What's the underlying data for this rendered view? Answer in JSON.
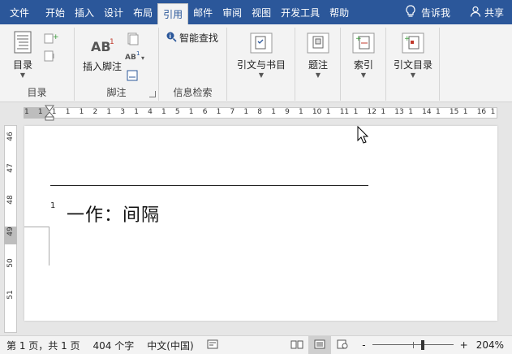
{
  "tabs": [
    {
      "label": "文件"
    },
    {
      "label": "开始"
    },
    {
      "label": "插入"
    },
    {
      "label": "设计"
    },
    {
      "label": "布局"
    },
    {
      "label": "引用"
    },
    {
      "label": "邮件"
    },
    {
      "label": "审阅"
    },
    {
      "label": "视图"
    },
    {
      "label": "开发工具"
    },
    {
      "label": "帮助"
    }
  ],
  "active_tab": "引用",
  "tell_me": "告诉我",
  "share": "共享",
  "ribbon": {
    "toc": {
      "label": "目录",
      "group": "目录"
    },
    "footnote": {
      "label": "插入脚注",
      "group": "脚注"
    },
    "research": {
      "label": "智能查找",
      "group": "信息检索"
    },
    "citations": {
      "label": "引文与书目"
    },
    "captions": {
      "label": "题注"
    },
    "index": {
      "label": "索引"
    },
    "toa": {
      "label": "引文目录"
    }
  },
  "hruler": {
    "labels": [
      "1",
      "1",
      "1",
      "1",
      "1",
      "2",
      "1",
      "3",
      "1",
      "4",
      "1",
      "5",
      "1",
      "6",
      "1",
      "7",
      "1",
      "8",
      "1",
      "9",
      "1",
      "10",
      "1",
      "11",
      "1",
      "12",
      "1",
      "13",
      "1",
      "14",
      "1",
      "15",
      "1",
      "16",
      "1"
    ]
  },
  "vruler": {
    "labels": [
      "46",
      "47",
      "48",
      "49",
      "50",
      "51"
    ]
  },
  "document": {
    "footnote_ref": "1",
    "footnote_text": "一作：间隔"
  },
  "status": {
    "page": "第 1 页，共 1 页",
    "words": "404 个字",
    "language": "中文(中国)",
    "zoom": "204%",
    "zoom_minus": "-",
    "zoom_plus": "+"
  },
  "colors": {
    "accent": "#2b579a"
  }
}
